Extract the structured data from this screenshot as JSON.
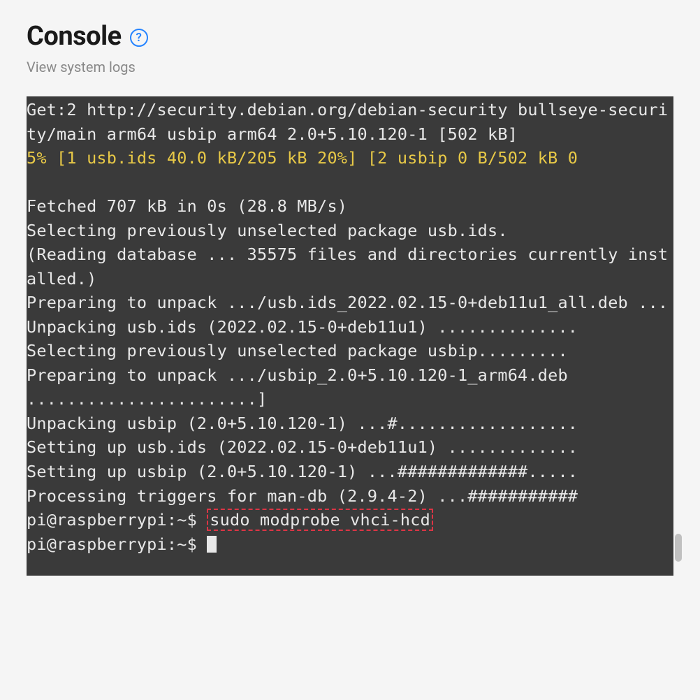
{
  "header": {
    "title": "Console",
    "help_symbol": "?",
    "subtitle": "View system logs"
  },
  "console": {
    "lines": [
      {
        "text": "Get:2 http://security.debian.org/debian-security bullseye-security/main arm64 usbip arm64 2.0+5.10.120-1 [502 kB]",
        "class": ""
      },
      {
        "text": "5% [1 usb.ids 40.0 kB/205 kB 20%] [2 usbip 0 B/502 kB 0",
        "class": "yellow"
      },
      {
        "text": " ",
        "class": ""
      },
      {
        "text": "Fetched 707 kB in 0s (28.8 MB/s)",
        "class": ""
      },
      {
        "text": "Selecting previously unselected package usb.ids.",
        "class": ""
      },
      {
        "text": "(Reading database ... 35575 files and directories currently installed.)",
        "class": ""
      },
      {
        "text": "Preparing to unpack .../usb.ids_2022.02.15-0+deb11u1_all.deb ...",
        "class": ""
      },
      {
        "text": "Unpacking usb.ids (2022.02.15-0+deb11u1) ..............",
        "class": ""
      },
      {
        "text": "Selecting previously unselected package usbip.........",
        "class": ""
      },
      {
        "text": "Preparing to unpack .../usbip_2.0+5.10.120-1_arm64.deb .......................]",
        "class": ""
      },
      {
        "text": "Unpacking usbip (2.0+5.10.120-1) ...#..................",
        "class": ""
      },
      {
        "text": "Setting up usb.ids (2022.02.15-0+deb11u1) .............",
        "class": ""
      },
      {
        "text": "Setting up usbip (2.0+5.10.120-1) ...#############.....",
        "class": ""
      },
      {
        "text": "Processing triggers for man-db (2.9.4-2) ...###########",
        "class": ""
      }
    ],
    "prompt1_prefix": "pi@raspberrypi:~$ ",
    "prompt1_cmd": "sudo modprobe vhci-hcd",
    "prompt2_prefix": "pi@raspberrypi:~$ "
  }
}
